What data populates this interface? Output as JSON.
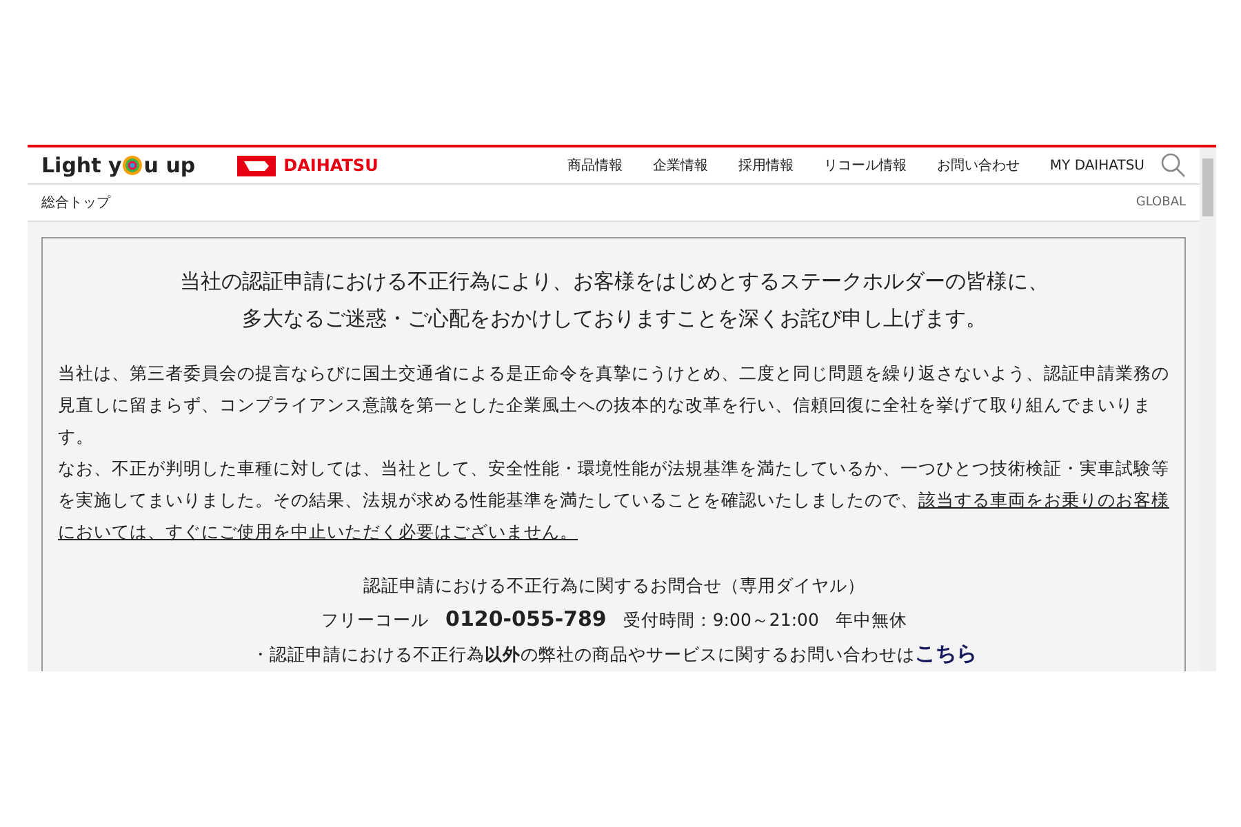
{
  "header": {
    "logo_text": [
      "Light y",
      "u up"
    ],
    "brand": "DAIHATSU",
    "nav": [
      "商品情報",
      "企業情報",
      "採用情報",
      "リコール情報",
      "お問い合わせ",
      "MY DAIHATSU"
    ]
  },
  "subbar": {
    "breadcrumb": "総合トップ",
    "global": "GLOBAL"
  },
  "notice": {
    "heading": [
      "当社の認証申請における不正行為により、お客様をはじめとするステークホルダーの皆様に、",
      "多大なるご迷惑・ご心配をおかけしておりますことを深くお詫び申し上げます。"
    ],
    "paragraph_1": "当社は、第三者委員会の提言ならびに国土交通省による是正命令を真摯にうけとめ、二度と同じ問題を繰り返さないよう、認証申請業務の見直しに留まらず、コンプライアンス意識を第一とした企業風土への抜本的な改革を行い、信頼回復に全社を挙げて取り組んでまいります。",
    "paragraph_2": "なお、不正が判明した車種に対しては、当社として、安全性能・環境性能が法規基準を満たしているか、一つひとつ技術検証・実車試験等を実施してまいりました。その結果、法規が求める性能基準を満たしていることを確認いたしましたので、",
    "paragraph_2_link": [
      "該当する車両をお乗りのお客様",
      "においては、すぐにご使用を中止いただく必要はございません。"
    ],
    "contact_title": "認証申請における不正行為に関するお問合せ（専用ダイヤル）",
    "freecall_label": "フリーコール",
    "phone": "0120-055-789",
    "hours": "受付時間：9:00～21:00",
    "days": "年中無休",
    "other_inquiry": "・認証申請における不正行為**以外**の弊社の商品やサービスに関するお問い合わせは",
    "other_link": "こちら"
  }
}
